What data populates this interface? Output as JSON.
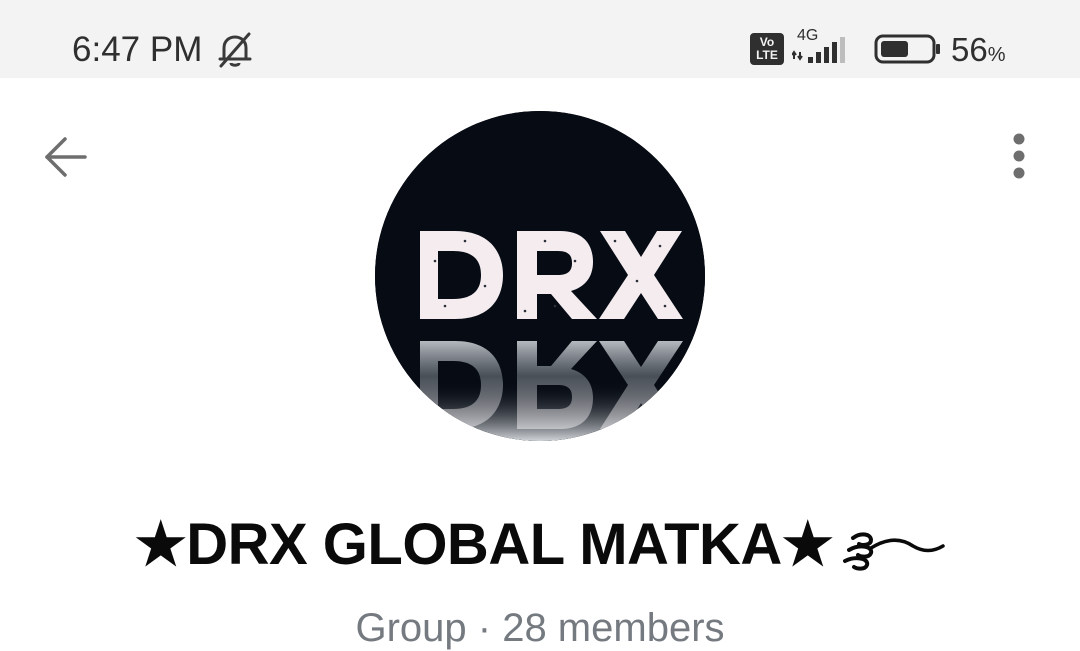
{
  "status_bar": {
    "time": "6:47 PM",
    "volte_top": "Vo",
    "volte_bottom": "LTE",
    "network": "4G",
    "battery_percent": "56",
    "battery_symbol": "%",
    "battery_level": 0.56,
    "icons": [
      "bell-off-icon",
      "volte-icon",
      "signal-icon",
      "battery-icon"
    ]
  },
  "toolbar": {
    "back_icon": "arrow-left-icon",
    "menu_icon": "more-vertical-icon"
  },
  "profile": {
    "avatar_text": "DRX",
    "name": "★DRX GLOBAL MATKA★",
    "name_trailing_glyph": "wave-squiggle",
    "subtitle": "Group · 28 members"
  },
  "colors": {
    "status_bar_bg": "#f3f3f3",
    "avatar_bg": "#060b14",
    "avatar_letters": "#f4ecef",
    "title": "#0a0a0a",
    "subtitle": "#747a80"
  }
}
